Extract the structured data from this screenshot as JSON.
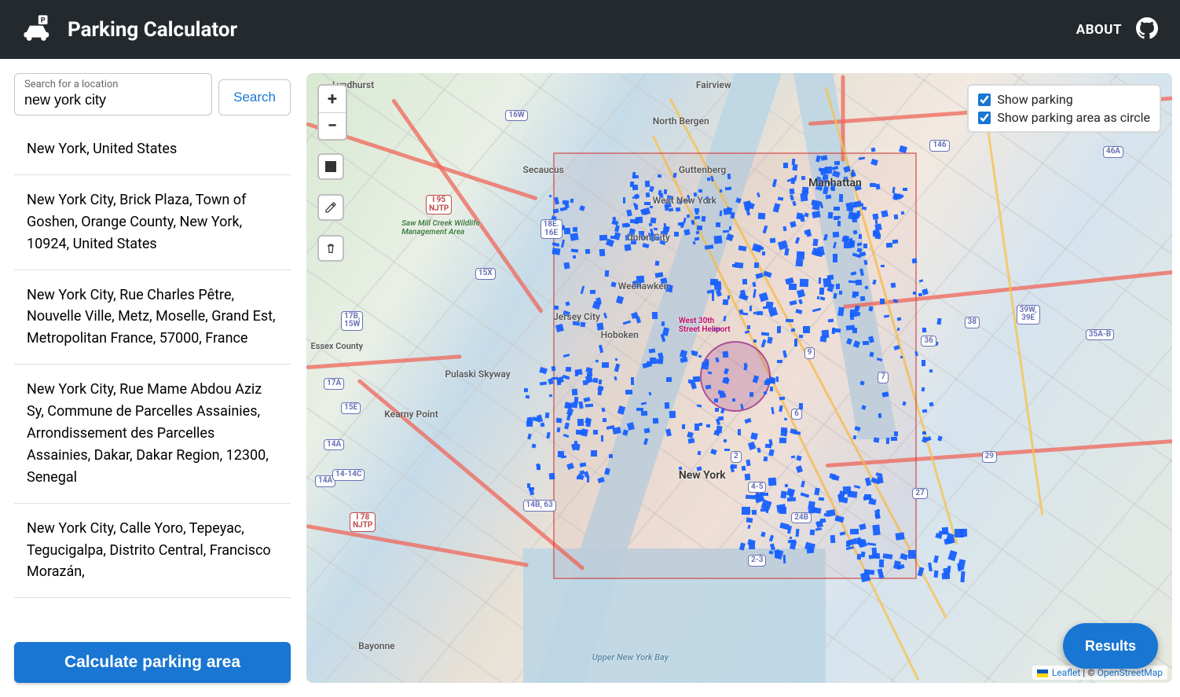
{
  "header": {
    "title": "Parking Calculator",
    "about": "ABOUT"
  },
  "search": {
    "label": "Search for a location",
    "value": "new york city",
    "button": "Search"
  },
  "results": [
    "New York, United States",
    "New York City, Brick Plaza, Town of Goshen, Orange County, New York, 10924, United States",
    "New York City, Rue Charles Pêtre, Nouvelle Ville, Metz, Moselle, Grand Est, Metropolitan France, 57000, France",
    "New York City, Rue Mame Abdou Aziz Sy, Commune de Parcelles Assainies, Arrondissement des Parcelles Assainies, Dakar, Dakar Region, 12300, Senegal",
    "New York City, Calle Yoro, Tepeyac, Tegucigalpa, Distrito Central, Francisco Morazán,"
  ],
  "calc_button": "Calculate parking area",
  "map": {
    "layers": {
      "parking": {
        "label": "Show parking",
        "checked": true
      },
      "circle": {
        "label": "Show parking area as circle",
        "checked": true
      }
    },
    "labels": {
      "lyndhurst": "Lyndhurst",
      "fairview": "Fairview",
      "north_bergen": "North Bergen",
      "secaucus": "Secaucus",
      "guttenberg": "Guttenberg",
      "west_ny": "West New York",
      "union_city": "Union City",
      "weehawken": "Weehawken",
      "manhattan": "Manhattan",
      "jersey_city": "Jersey City",
      "hoboken": "Hoboken",
      "kearny": "Kearny Point",
      "pulaski": "Pulaski Skyway",
      "ny": "New York",
      "bayonne": "Bayonne",
      "nj_heliport": "West 30th Street Heliport",
      "sawmill": "Saw Mill Creek Wildlife Management Area",
      "upper_bay": "Upper New York Bay",
      "essex": "Essex County"
    },
    "shields": {
      "i95": "I 95\nNJTP",
      "i78": "I 78\nNJTP",
      "s16w": "16W",
      "s18e": "18E.\n16E",
      "s15x": "15X",
      "s17b": "17B,\n15W",
      "s14a": "14A",
      "s14a2": "14A",
      "s14c": "14-14C",
      "s14b": "14B, 63",
      "s17a": "17A",
      "s15e": "15E",
      "s146": "146",
      "s46a": "46A",
      "s39w": "39W,\n39E",
      "s35a": "35A-B",
      "s36": "36",
      "s38": "38",
      "s29": "29",
      "s24b": "24B",
      "s27": "27",
      "s2_3": "2-3",
      "s9": "9",
      "s6": "6",
      "s2": "2",
      "s4_5": "4-5",
      "s7": "7"
    },
    "attribution": {
      "leaflet": "Leaflet",
      "sep": " | © ",
      "osm": "OpenStreetMap"
    },
    "results_fab": "Results"
  }
}
